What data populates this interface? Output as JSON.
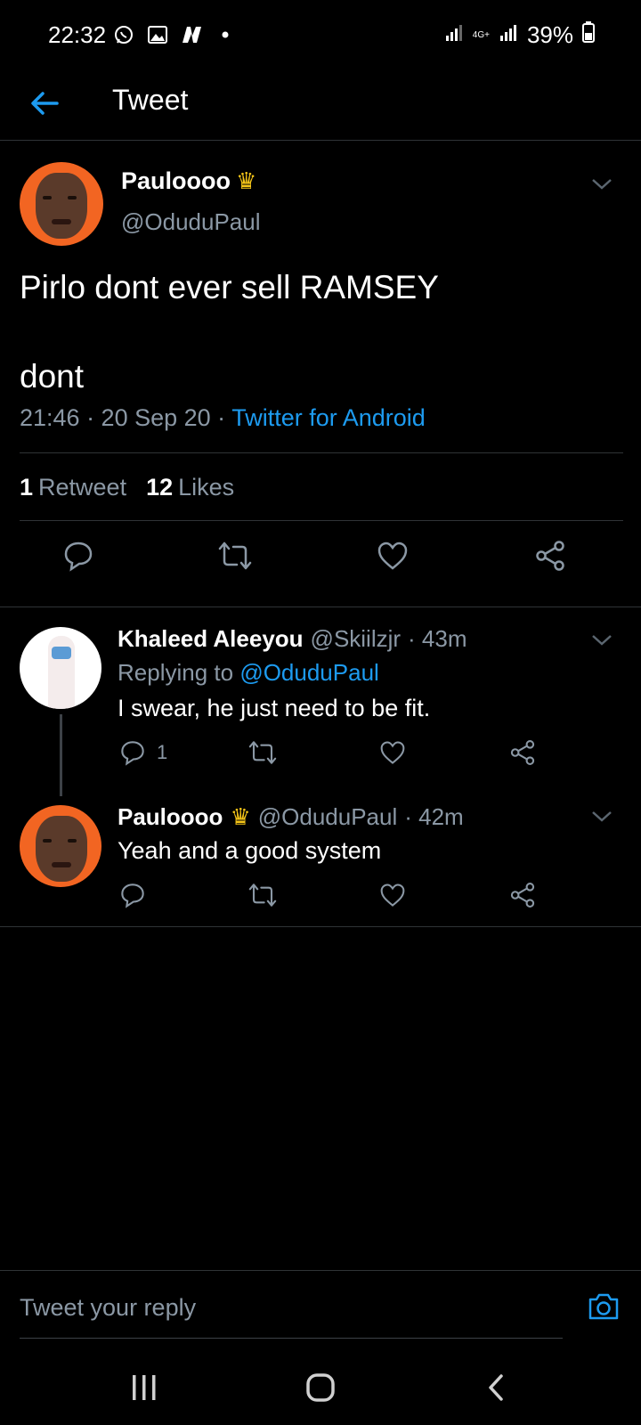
{
  "status_bar": {
    "time": "22:32",
    "network": "4G+",
    "battery": "39%"
  },
  "header": {
    "title": "Tweet"
  },
  "main_tweet": {
    "name": "Pauloooo",
    "handle": "@OduduPaul",
    "text": "Pirlo dont ever sell RAMSEY\n\ndont",
    "time": "21:46 · 20 Sep 20 · ",
    "source": "Twitter for Android",
    "retweet_count": "1",
    "retweet_label": "Retweet",
    "like_count": "12",
    "like_label": "Likes"
  },
  "replies": [
    {
      "name": "Khaleed Aleeyou",
      "handle": "@Skiilzjr",
      "age": "· 43m",
      "replying_prefix": "Replying to ",
      "replying_to": "@OduduPaul",
      "text": "I swear, he just need to be fit.",
      "reply_count": "1"
    },
    {
      "name": "Pauloooo",
      "handle": "@OduduPaul",
      "age": "· 42m",
      "text": "Yeah and a good system"
    }
  ],
  "composer": {
    "placeholder": "Tweet your reply"
  },
  "colors": {
    "accent": "#1d9bf0",
    "background": "#000000",
    "secondary_text": "#8b98a5",
    "avatar_orange": "#f26522"
  }
}
